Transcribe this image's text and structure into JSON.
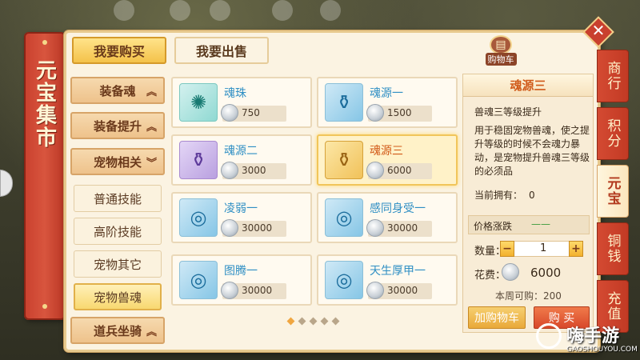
{
  "title": "元宝集市",
  "tabs": {
    "buy": "我要购买",
    "sell": "我要出售"
  },
  "cart_label": "购物车",
  "categories": [
    {
      "label": "装备魂",
      "arrow": "︽"
    },
    {
      "label": "装备提升",
      "arrow": "︽"
    },
    {
      "label": "宠物相关",
      "arrow": "︾"
    }
  ],
  "subcategories": [
    "普通技能",
    "高阶技能",
    "宠物其它",
    "宠物兽魂"
  ],
  "bottom_category": {
    "label": "道兵坐骑",
    "arrow": "︽"
  },
  "items": [
    {
      "name": "魂珠",
      "price": "750"
    },
    {
      "name": "魂源一",
      "price": "1500"
    },
    {
      "name": "魂源二",
      "price": "3000"
    },
    {
      "name": "魂源三",
      "price": "6000"
    },
    {
      "name": "凌弱一",
      "price": "30000"
    },
    {
      "name": "感同身受一",
      "price": "30000"
    },
    {
      "name": "图腾一",
      "price": "30000"
    },
    {
      "name": "天生厚甲一",
      "price": "30000"
    }
  ],
  "detail": {
    "title": "魂源三",
    "subtitle": "兽魂三等级提升",
    "description": "用于稳固宠物兽魂，使之提升等级的时候不会魂力暴动，是宠物提升兽魂三等级的必须品",
    "owned_label": "当前拥有：",
    "owned_value": "0",
    "rise_label": "价格涨跌",
    "rise_value": "——",
    "qty_label": "数量：",
    "qty_minus": "−",
    "qty_plus": "+",
    "qty_value": "1",
    "cost_label": "花费：",
    "cost_value": "6000",
    "weekly_label": "本周可购：",
    "weekly_value": "200",
    "add_cart": "加购物车",
    "buy": "购 买"
  },
  "side_tabs": [
    "商行",
    "积分",
    "元宝",
    "铜钱",
    "充值"
  ],
  "close": "✕",
  "watermark": {
    "name": "嗨手游",
    "url": "GAOSHOUYOU.COM"
  },
  "colors": {
    "accent_red": "#c9402e",
    "gold": "#f4c24a",
    "panel_bg": "#fbf3e2"
  }
}
